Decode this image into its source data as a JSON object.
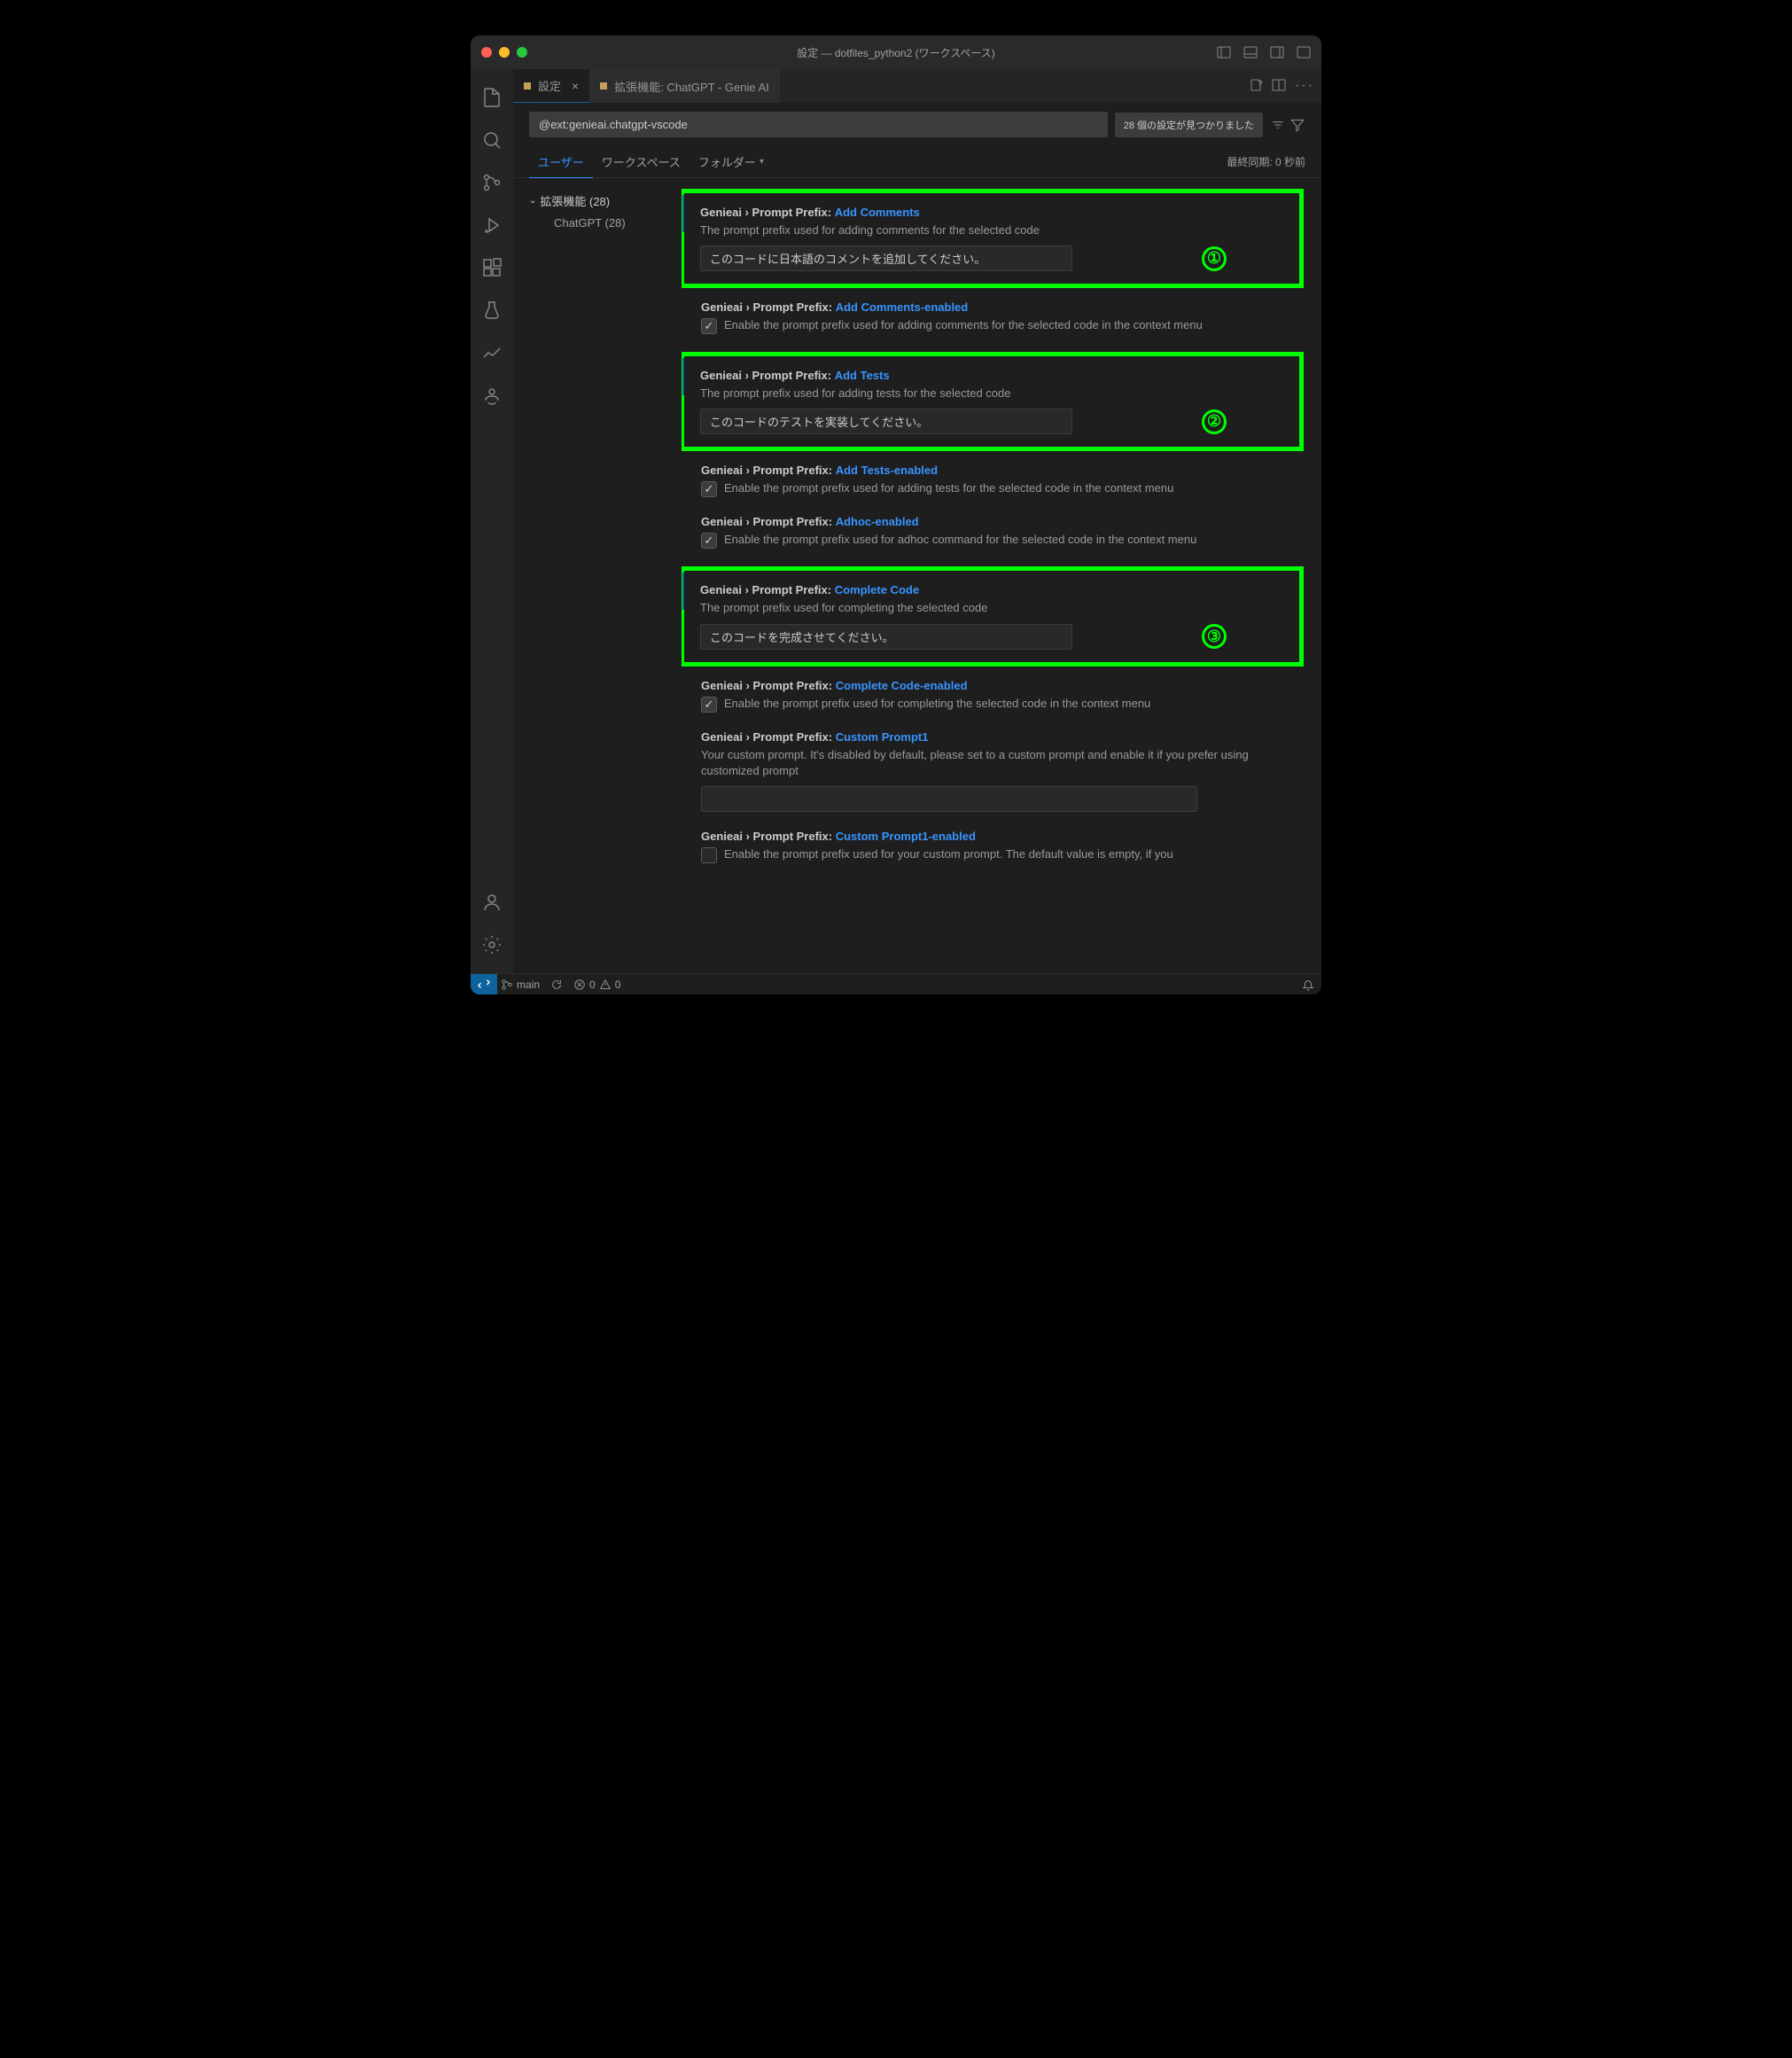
{
  "window": {
    "title": "設定 — dotfiles_python2 (ワークスペース)"
  },
  "tabs": {
    "active": "設定",
    "inactive": "拡張機能: ChatGPT - Genie AI"
  },
  "search": {
    "value": "@ext:genieai.chatgpt-vscode",
    "count": "28 個の設定が見つかりました"
  },
  "scope": {
    "user": "ユーザー",
    "workspace": "ワークスペース",
    "folder": "フォルダー",
    "sync": "最終同期: 0 秒前"
  },
  "toc": {
    "ext": "拡張機能 (28)",
    "chatgpt": "ChatGPT (28)"
  },
  "settings": {
    "addComments": {
      "path": "Genieai › Prompt Prefix:",
      "key": "Add Comments",
      "desc": "The prompt prefix used for adding comments for the selected code",
      "value": "このコードに日本語のコメントを追加してください。",
      "badge": "①"
    },
    "addCommentsEnabled": {
      "path": "Genieai › Prompt Prefix:",
      "key": "Add Comments-enabled",
      "desc": "Enable the prompt prefix used for adding comments for the selected code in the context menu"
    },
    "addTests": {
      "path": "Genieai › Prompt Prefix:",
      "key": "Add Tests",
      "desc": "The prompt prefix used for adding tests for the selected code",
      "value": "このコードのテストを実装してください。",
      "badge": "②"
    },
    "addTestsEnabled": {
      "path": "Genieai › Prompt Prefix:",
      "key": "Add Tests-enabled",
      "desc": "Enable the prompt prefix used for adding tests for the selected code in the context menu"
    },
    "adhocEnabled": {
      "path": "Genieai › Prompt Prefix:",
      "key": "Adhoc-enabled",
      "desc": "Enable the prompt prefix used for adhoc command for the selected code in the context menu"
    },
    "completeCode": {
      "path": "Genieai › Prompt Prefix:",
      "key": "Complete Code",
      "desc": "The prompt prefix used for completing the selected code",
      "value": "このコードを完成させてください。",
      "badge": "③"
    },
    "completeCodeEnabled": {
      "path": "Genieai › Prompt Prefix:",
      "key": "Complete Code-enabled",
      "desc": "Enable the prompt prefix used for completing the selected code in the context menu"
    },
    "customPrompt1": {
      "path": "Genieai › Prompt Prefix:",
      "key": "Custom Prompt1",
      "desc": "Your custom prompt. It's disabled by default, please set to a custom prompt and enable it if you prefer using customized prompt",
      "value": ""
    },
    "customPrompt1Enabled": {
      "path": "Genieai › Prompt Prefix:",
      "key": "Custom Prompt1-enabled",
      "desc": "Enable the prompt prefix used for your custom prompt. The default value is empty, if you"
    }
  },
  "status": {
    "branch": "main",
    "errors": "0",
    "warnings": "0"
  }
}
